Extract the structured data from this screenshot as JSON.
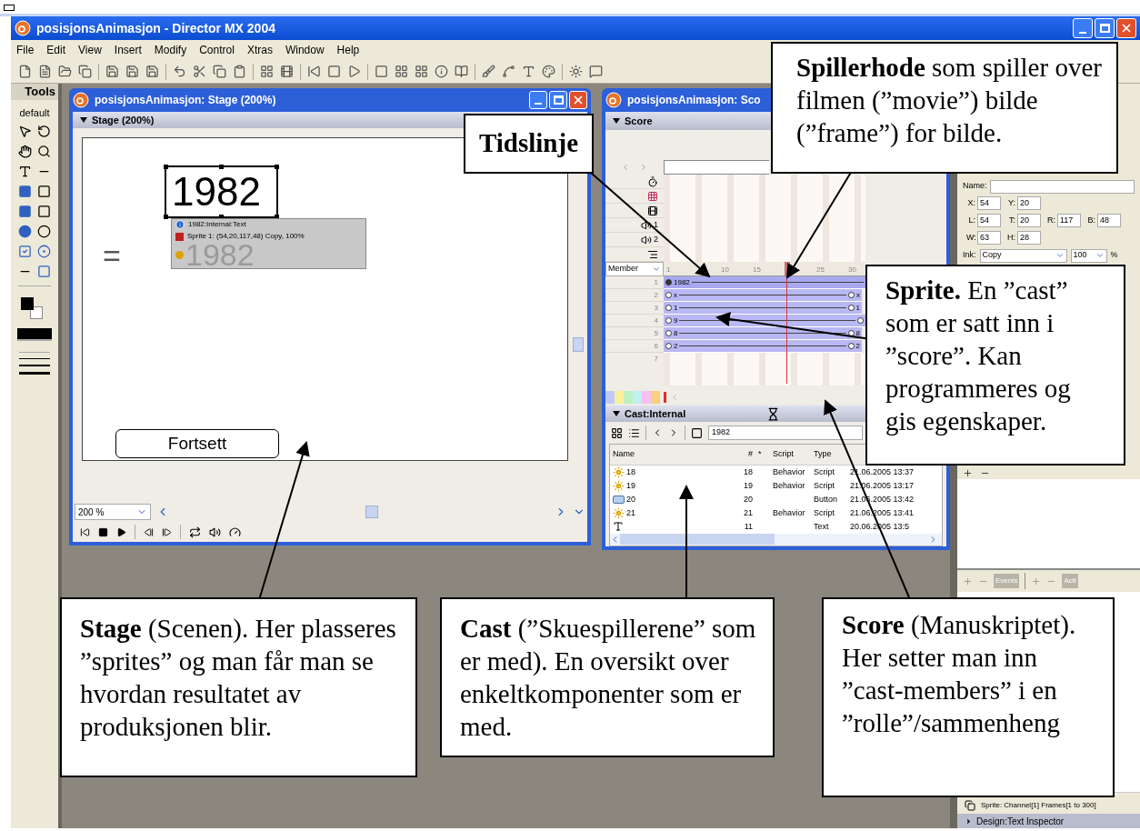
{
  "app_window": {
    "title": "posisjonsAnimasjon - Director MX 2004"
  },
  "menu": [
    "File",
    "Edit",
    "View",
    "Insert",
    "Modify",
    "Control",
    "Xtras",
    "Window",
    "Help"
  ],
  "tools_panel": {
    "title": "Tools",
    "preset": "default"
  },
  "stage_window": {
    "title": "posisjonsAnimasjon: Stage (200%)",
    "panel_title": "Stage (200%)",
    "text_sprite": "1982",
    "equals_sign": "=",
    "tooltip": {
      "member": "1982:Internal:Text",
      "sprite": "Sprite 1: (54,20,117,48) Copy, 100%",
      "ghost_text": "1982"
    },
    "button_sprite": "Fortsett",
    "zoom": "200 %"
  },
  "score_window": {
    "title": "posisjonsAnimasjon: Sco",
    "panel_title": "Score",
    "effect_channels": [
      {
        "kind": "tempo"
      },
      {
        "kind": "palette"
      },
      {
        "kind": "transition"
      },
      {
        "kind": "sound",
        "label": "1"
      },
      {
        "kind": "sound",
        "label": "2"
      },
      {
        "kind": "script"
      }
    ],
    "label_mode": "Member",
    "frame_ticks": [
      "1",
      "10",
      "15",
      "25",
      "30"
    ],
    "sprites": [
      {
        "channel": "1",
        "label": "1982",
        "selected": true
      },
      {
        "channel": "2",
        "label": "x",
        "end_label": "x",
        "selected": false
      },
      {
        "channel": "3",
        "label": "1",
        "end_label": "1",
        "selected": false
      },
      {
        "channel": "4",
        "label": "9",
        "selected": false
      },
      {
        "channel": "5",
        "label": "8",
        "end_label": "8",
        "selected": false
      },
      {
        "channel": "6",
        "label": "2",
        "end_label": "2",
        "selected": false
      }
    ],
    "empty_channels": [
      "7"
    ]
  },
  "cast": {
    "title": "Cast:Internal",
    "selected_member": "1982",
    "columns": [
      "Name",
      "#",
      "*",
      "Script",
      "Type"
    ],
    "rows": [
      {
        "kind": "behavior",
        "name": "18",
        "number": "18",
        "script": "Behavior",
        "type": "Script",
        "modified": "21.06.2005 13:37"
      },
      {
        "kind": "behavior",
        "name": "19",
        "number": "19",
        "script": "Behavior",
        "type": "Script",
        "modified": "21.06.2005 13:17"
      },
      {
        "kind": "button",
        "name": "20",
        "number": "20",
        "type": "Button",
        "modified": "21.06.2005 13:42"
      },
      {
        "kind": "behavior",
        "name": "21",
        "number": "21",
        "script": "Behavior",
        "type": "Script",
        "modified": "21.06.2005 13:41"
      },
      {
        "kind": "text",
        "number": "11",
        "type": "Text",
        "modified": "20.06.2005 13:5"
      }
    ]
  },
  "inspector": {
    "name_label": "Name:",
    "field_rows": [
      [
        {
          "label": "X:",
          "value": "54"
        },
        {
          "label": "Y:",
          "value": "20"
        }
      ],
      [
        {
          "label": "L:",
          "value": "54"
        },
        {
          "label": "T:",
          "value": "20"
        },
        {
          "label": "R:",
          "value": "117"
        },
        {
          "label": "B:",
          "value": "48"
        }
      ],
      [
        {
          "label": "W:",
          "value": "63"
        },
        {
          "label": "H:",
          "value": "28"
        }
      ]
    ],
    "ink_label": "Ink:",
    "ink": "Copy",
    "blend": "100",
    "blend_unit": "%",
    "behavior_buttons": [
      "Events",
      "Acti"
    ],
    "status": "Sprite: Channel[1] Frames[1 to 300]",
    "next_panel": "Design:Text Inspector"
  },
  "callouts": [
    {
      "kind": "heading",
      "text": "Tidslinje"
    },
    {
      "kind": "note",
      "text": "**Spillerhode** som spiller over filmen (”movie”) bilde (”frame”) for bilde."
    },
    {
      "kind": "note",
      "text": "**Sprite.** En ”cast” som er satt inn i ”score”. Kan programmeres og gis egenskaper."
    },
    {
      "kind": "note",
      "text": "**Stage** (Scenen). Her plasseres ”sprites” og man får man se hvordan resultatet av produksjonen blir."
    },
    {
      "kind": "note",
      "text": "**Cast** (”Skuespillerene” som er med). En oversikt over enkeltkomponenter som er med."
    },
    {
      "kind": "note",
      "text": "**Score** (Manuskriptet). Her setter man inn ”cast-members” i en ”rolle”/sammenheng"
    }
  ]
}
